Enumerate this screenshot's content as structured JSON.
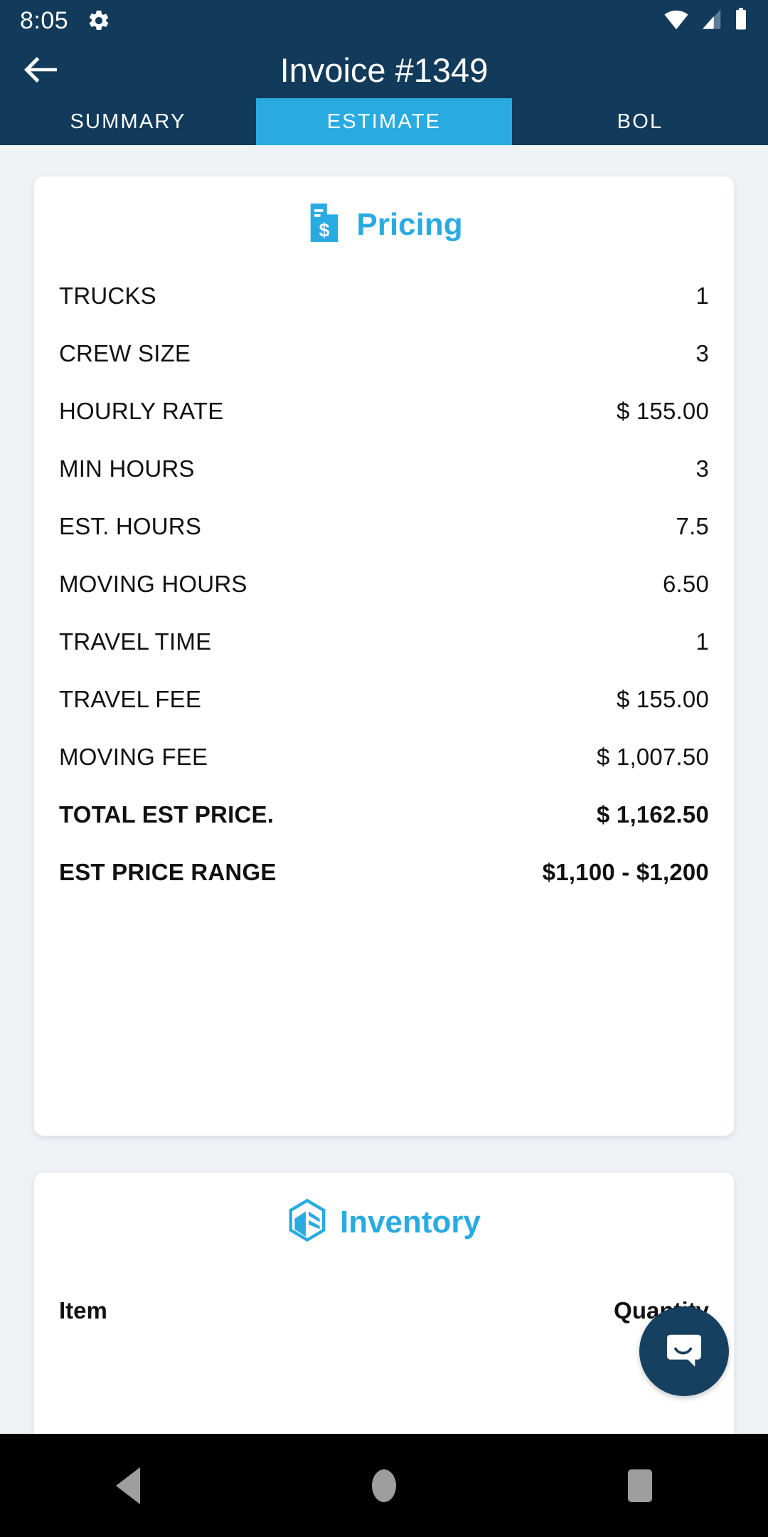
{
  "status_bar": {
    "time": "8:05",
    "icons": [
      "gear-icon",
      "wifi-icon",
      "cellular-signal-icon",
      "battery-icon"
    ]
  },
  "app_bar": {
    "back_icon": "arrow-left-icon",
    "title": "Invoice #1349"
  },
  "tabs": [
    {
      "label": "SUMMARY",
      "active": false
    },
    {
      "label": "ESTIMATE",
      "active": true
    },
    {
      "label": "BOL",
      "active": false
    }
  ],
  "pricing_card": {
    "icon": "invoice-dollar-icon",
    "title": "Pricing",
    "rows": [
      {
        "label": "TRUCKS",
        "value": "1",
        "bold": false
      },
      {
        "label": "CREW SIZE",
        "value": "3",
        "bold": false
      },
      {
        "label": "HOURLY RATE",
        "value": "$ 155.00",
        "bold": false
      },
      {
        "label": "MIN HOURS",
        "value": "3",
        "bold": false
      },
      {
        "label": "EST. HOURS",
        "value": "7.5",
        "bold": false
      },
      {
        "label": "MOVING HOURS",
        "value": "6.50",
        "bold": false
      },
      {
        "label": "TRAVEL TIME",
        "value": "1",
        "bold": false
      },
      {
        "label": "TRAVEL FEE",
        "value": "$ 155.00",
        "bold": false
      },
      {
        "label": "MOVING FEE",
        "value": "$ 1,007.50",
        "bold": false
      },
      {
        "label": "TOTAL EST PRICE.",
        "value": "$ 1,162.50",
        "bold": true
      },
      {
        "label": "EST PRICE RANGE",
        "value": "$1,100 - $1,200",
        "bold": true
      }
    ]
  },
  "inventory_card": {
    "icon": "box-cube-icon",
    "title": "Inventory",
    "columns": [
      "Item",
      "Quantity"
    ]
  },
  "chat_fab": {
    "icon": "chat-bubble-icon"
  },
  "nav_bar": {
    "back_label": "back-icon",
    "home_label": "home-icon",
    "recents_label": "recents-icon"
  },
  "colors": {
    "header_navy": "#123a5a",
    "accent_cyan": "#29abe2",
    "page_background": "#eff3f6",
    "card_background": "#ffffff",
    "fab_navy": "#16405f",
    "nav_icon_gray": "#9e9e9e"
  }
}
